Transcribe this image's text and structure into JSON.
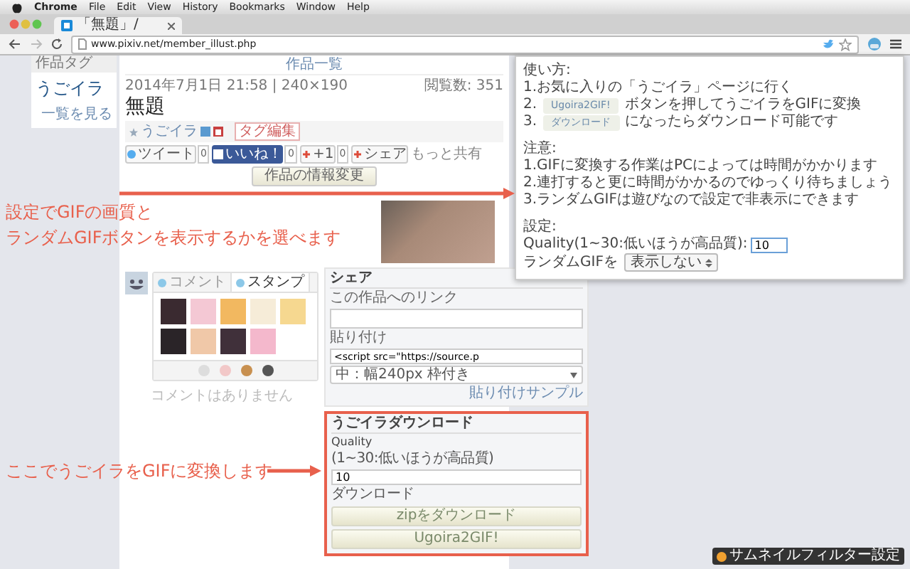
{
  "menu_bar": {
    "app": "Chrome",
    "items": [
      "File",
      "Edit",
      "View",
      "History",
      "Bookmarks",
      "Window",
      "Help"
    ]
  },
  "browser_tab": {
    "title": "「無題」/"
  },
  "address_bar": {
    "url": "www.pixiv.net/member_illust.php"
  },
  "tag_box": {
    "heading": "作品タグ",
    "tag": "うごイラ",
    "link": "一覧を見る"
  },
  "work": {
    "nav_link": "作品一覧",
    "meta": "2014年7月1日 21:58 | 240×190",
    "views": "閲覧数: 351",
    "title": "無題",
    "tag": "うごイラ",
    "tag_edit": "タグ編集",
    "share_buttons": [
      {
        "kind": "twitter",
        "label": "ツイート",
        "count": "0"
      },
      {
        "kind": "facebook",
        "label": "いいね！",
        "count": "0"
      },
      {
        "kind": "gplus",
        "label": "+1",
        "count": "0"
      },
      {
        "kind": "share",
        "label": "シェア"
      }
    ],
    "more_share": "もっと共有",
    "edit_button": "作品の情報変更"
  },
  "comments": {
    "tabs": [
      {
        "label": "コメント",
        "selected": false
      },
      {
        "label": "スタンプ",
        "selected": true
      }
    ],
    "empty_text": "コメントはありません"
  },
  "share_panel": {
    "heading": "シェア",
    "link_label": "この作品へのリンク",
    "embed_label": "貼り付け",
    "embed_code": "<script src=\"https://source.p",
    "embed_size": "中：幅240px 枠付き",
    "sample_link": "貼り付けサンプル"
  },
  "download_panel": {
    "heading": "うごイラダウンロード",
    "quality_label": "Quality",
    "quality_hint": "(1~30:低いほうが高品質)",
    "quality_value": "10",
    "download_label": "ダウンロード",
    "buttons": [
      "zipをダウンロード",
      "Ugoira2GIF!"
    ]
  },
  "popup": {
    "usage_heading": "使い方:",
    "usage": [
      {
        "number": "1.",
        "text": "お気に入りの「うごイラ」ページに行く"
      },
      {
        "number": "2.",
        "chip": "Ugoira2GIF!",
        "text": "ボタンを押してうごイラをGIFに変換"
      },
      {
        "number": "3.",
        "chip": "ダウンロード",
        "text": "になったらダウンロード可能です"
      }
    ],
    "notes_heading": "注意:",
    "notes": [
      "1.GIFに変換する作業はPCによっては時間がかかります",
      "2.連打すると更に時間がかかるのでゆっくり待ちましょう",
      "3.ランダムGIFは遊びなので設定で非表示にできます"
    ],
    "settings_heading": "設定:",
    "quality_label": "Quality(1~30:低いほうが高品質):",
    "quality_value": "10",
    "random_label": "ランダムGIFを",
    "random_value": "表示しない"
  },
  "annotations": [
    {
      "lines": [
        "設定でGIFの画質と",
        "ランダムGIFボタンを表示するかを選べます"
      ]
    },
    {
      "lines": [
        "ここでうごイラをGIFに変換します"
      ]
    }
  ],
  "filter_badge": "サムネイルフィルター設定"
}
